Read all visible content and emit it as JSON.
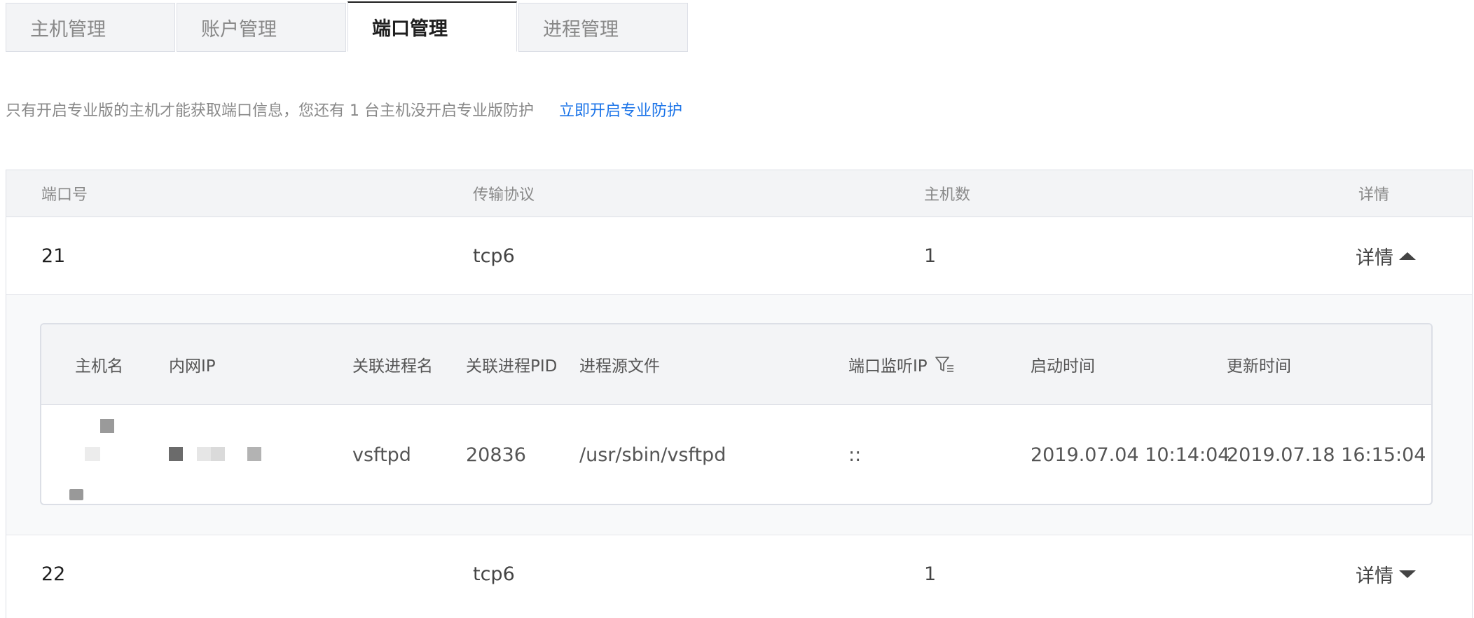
{
  "tabs": [
    {
      "label": "主机管理",
      "active": false
    },
    {
      "label": "账户管理",
      "active": false
    },
    {
      "label": "端口管理",
      "active": true
    },
    {
      "label": "进程管理",
      "active": false
    }
  ],
  "notice": {
    "text": "只有开启专业版的主机才能获取端口信息，您还有 1 台主机没开启专业版防护",
    "link": "立即开启专业防护"
  },
  "table": {
    "columns": [
      "端口号",
      "传输协议",
      "主机数",
      "详情"
    ],
    "rows": [
      {
        "port": "21",
        "protocol": "tcp6",
        "hosts": "1",
        "details": "详情",
        "expanded": true
      },
      {
        "port": "22",
        "protocol": "tcp6",
        "hosts": "1",
        "details": "详情",
        "expanded": false
      }
    ]
  },
  "subtable": {
    "columns": [
      "主机名",
      "内网IP",
      "关联进程名",
      "关联进程PID",
      "进程源文件",
      "端口监听IP",
      "启动时间",
      "更新时间"
    ],
    "rows": [
      {
        "process_name": "vsftpd",
        "pid": "20836",
        "source_file": "/usr/sbin/vsftpd",
        "listen_ip": "::",
        "start_time": "2019.07.04 10:14:04",
        "update_time": "2019.07.18 16:15:04"
      }
    ]
  },
  "icons": {
    "expand_up": "caret-up-icon",
    "expand_down": "caret-down-icon",
    "filter": "filter-icon"
  },
  "colors": {
    "link": "#1a73e8",
    "header_bg": "#f3f4f6",
    "border": "#dcdfe6"
  }
}
